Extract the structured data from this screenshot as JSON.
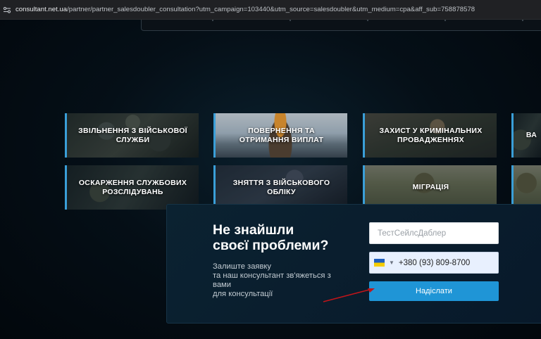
{
  "browser": {
    "url_host": "consultant.net.ua",
    "url_path": "/partner/partner_salesdoubler_consultation?utm_campaign=103440&utm_source=salesdoubler&utm_medium=cpa&aff_sub=758878578"
  },
  "services": {
    "row1": [
      {
        "label": "Звільнення з військової служби",
        "icon": "camo-soldiers"
      },
      {
        "label": "Повернення та отримання виплат",
        "icon": "soldier-sky"
      },
      {
        "label": "Захист у кримінальних провадженнях",
        "icon": "soldier-field"
      }
    ],
    "row2": [
      {
        "label": "Оскарження службових розслідувань",
        "icon": "soldier-dark"
      },
      {
        "label": "Зняття з військового обліку",
        "icon": "soldiers-march"
      },
      {
        "label": "Міграція",
        "icon": "soldier-grass"
      }
    ],
    "partial_row1_label": "ВА"
  },
  "form": {
    "heading_line1": "Не знайшли",
    "heading_line2": "своєї проблеми?",
    "sub_lines": [
      "Залиште заявку",
      "та наш консультант зв'яжеться з",
      "вами",
      "для консультації"
    ],
    "name_placeholder": "ТестСейлсДаблер",
    "phone_value": "+380 (93) 809-8700",
    "country": "ukraine-flag-icon",
    "submit_label": "Надіслати"
  },
  "colors": {
    "accent": "#1f95d6",
    "card_border": "#3a9fd8",
    "arrow": "#c0151a"
  }
}
